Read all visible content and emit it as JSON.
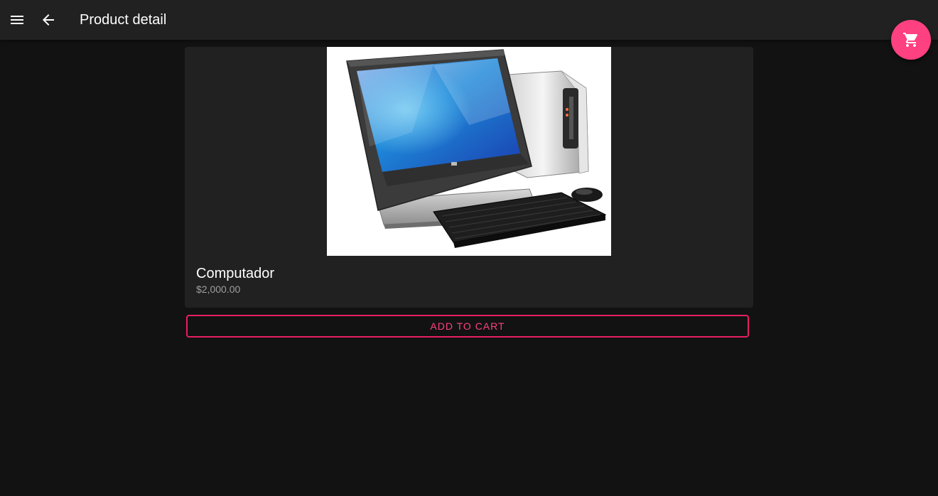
{
  "header": {
    "title": "Product detail"
  },
  "product": {
    "name": "Computador",
    "price": "$2,000.00"
  },
  "actions": {
    "add_to_cart_label": "ADD TO CART"
  },
  "icons": {
    "menu": "menu-icon",
    "back": "arrow-back-icon",
    "cart": "shopping-cart-icon"
  },
  "colors": {
    "background": "#121212",
    "app_bar": "#212121",
    "card": "#212121",
    "accent": "#ff4081",
    "price_text": "#9e9e9e"
  }
}
